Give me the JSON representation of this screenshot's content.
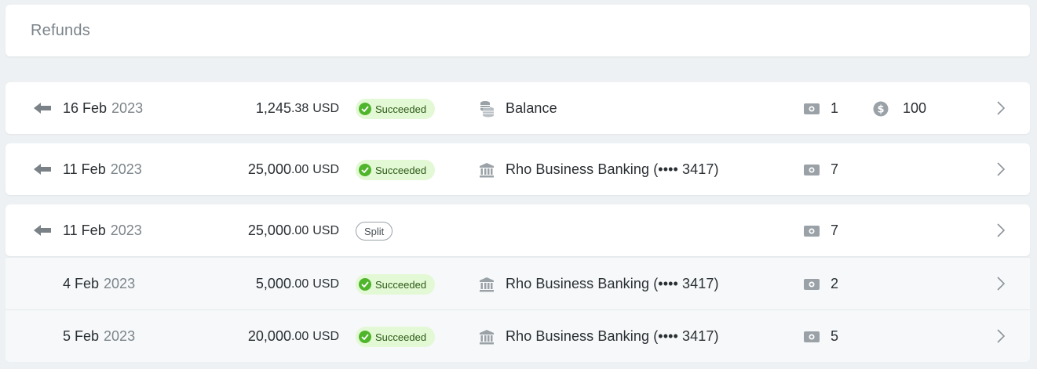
{
  "header": {
    "title": "Refunds"
  },
  "rows": [
    {
      "date_day": "16 Feb",
      "date_year": "2023",
      "amount_whole": "1,245",
      "amount_cents": ".38",
      "currency": "USD",
      "status": "Succeeded",
      "method": "Balance",
      "doc_count": "1",
      "coin_count": "100"
    },
    {
      "date_day": "11 Feb",
      "date_year": "2023",
      "amount_whole": "25,000",
      "amount_cents": ".00",
      "currency": "USD",
      "status": "Succeeded",
      "method": "Rho Business Banking (•••• 3417)",
      "doc_count": "7"
    },
    {
      "date_day": "11 Feb",
      "date_year": "2023",
      "amount_whole": "25,000",
      "amount_cents": ".00",
      "currency": "USD",
      "status": "Split",
      "doc_count": "7"
    },
    {
      "date_day": "4 Feb",
      "date_year": "2023",
      "amount_whole": "5,000",
      "amount_cents": ".00",
      "currency": "USD",
      "status": "Succeeded",
      "method": "Rho Business Banking (•••• 3417)",
      "doc_count": "2"
    },
    {
      "date_day": "5 Feb",
      "date_year": "2023",
      "amount_whole": "20,000",
      "amount_cents": ".00",
      "currency": "USD",
      "status": "Succeeded",
      "method": "Rho Business Banking (•••• 3417)",
      "doc_count": "5"
    }
  ],
  "icons": {
    "arrow": "arrow-left-icon",
    "balance": "coins-stack-icon",
    "bank": "bank-icon",
    "doc": "banknote-icon",
    "coin": "dollar-coin-icon",
    "chevron": "chevron-right-icon",
    "check": "check-circle-icon"
  },
  "colors": {
    "success_bg": "#e3f8d4",
    "success_icon": "#4fb52a",
    "muted": "#7c858b",
    "background": "#eef1f3"
  }
}
